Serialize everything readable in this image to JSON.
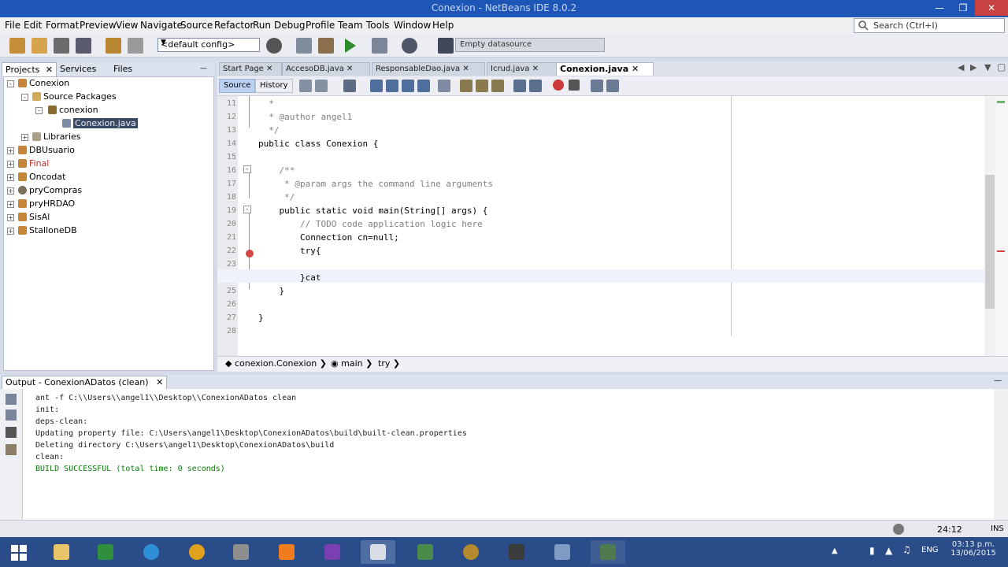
{
  "window": {
    "title": "Conexion - NetBeans IDE 8.0.2"
  },
  "menu": [
    "File",
    "Edit",
    "Format",
    "Preview",
    "View",
    "Navigate",
    "Source",
    "Refactor",
    "Run",
    "Debug",
    "Profile",
    "Team",
    "Tools",
    "Window",
    "Help"
  ],
  "search": {
    "placeholder": "Search (Ctrl+I)"
  },
  "toolbar": {
    "config": "<default config>",
    "datasource": "Empty datasource"
  },
  "left_panel": {
    "tabs": [
      "Projects",
      "Services",
      "Files"
    ],
    "tree": [
      {
        "label": "Conexion",
        "level": 0
      },
      {
        "label": "Source Packages",
        "level": 1
      },
      {
        "label": "conexion",
        "level": 2
      },
      {
        "label": "Conexion.java",
        "level": 3,
        "selected": true
      },
      {
        "label": "Libraries",
        "level": 1
      },
      {
        "label": "DBUsuario",
        "level": 0
      },
      {
        "label": "Final",
        "level": 0,
        "color": "#c62828"
      },
      {
        "label": "Oncodat",
        "level": 0
      },
      {
        "label": "pryCompras",
        "level": 0
      },
      {
        "label": "pryHRDAO",
        "level": 0
      },
      {
        "label": "SisAl",
        "level": 0
      },
      {
        "label": "StalloneDB",
        "level": 0
      }
    ]
  },
  "editor": {
    "tabs": [
      "Start Page",
      "AccesoDB.java",
      "ResponsableDao.java",
      "Icrud.java",
      "Conexion.java"
    ],
    "active_tab": "Conexion.java",
    "view_tabs": [
      "Source",
      "History"
    ],
    "lines": [
      {
        "n": "11",
        "text": "  *"
      },
      {
        "n": "12",
        "text": "  * @author angel1"
      },
      {
        "n": "13",
        "text": "  */"
      },
      {
        "n": "14",
        "text": "public class Conexion {"
      },
      {
        "n": "15",
        "text": ""
      },
      {
        "n": "16",
        "text": "    /**"
      },
      {
        "n": "17",
        "text": "     * @param args the command line arguments"
      },
      {
        "n": "18",
        "text": "     */"
      },
      {
        "n": "19",
        "text": "    public static void main(String[] args) {"
      },
      {
        "n": "20",
        "text": "        // TODO code application logic here"
      },
      {
        "n": "21",
        "text": "        Connection cn=null;"
      },
      {
        "n": "22",
        "text": "        try{"
      },
      {
        "n": "23",
        "text": ""
      },
      {
        "n": "24",
        "text": "        }cat"
      },
      {
        "n": "25",
        "text": "    }"
      },
      {
        "n": "26",
        "text": ""
      },
      {
        "n": "27",
        "text": "}"
      },
      {
        "n": "28",
        "text": ""
      }
    ],
    "breadcrumb": [
      "conexion.Conexion",
      "main",
      "try"
    ]
  },
  "output": {
    "title": "Output - ConexionADatos (clean)",
    "lines": [
      "ant -f C:\\\\Users\\\\angel1\\\\Desktop\\\\ConexionADatos clean",
      "init:",
      "deps-clean:",
      "Updating property file: C:\\Users\\angel1\\Desktop\\ConexionADatos\\build\\built-clean.properties",
      "Deleting directory C:\\Users\\angel1\\Desktop\\ConexionADatos\\build",
      "clean:",
      "BUILD SUCCESSFUL (total time: 0 seconds)"
    ]
  },
  "status": {
    "position": "24:12",
    "mode": "INS"
  },
  "taskbar": {
    "lang": "ENG",
    "time": "03:13 p.m.",
    "date": "13/06/2015"
  },
  "colors": {
    "accent": "#1e56b7",
    "taskbar": "#2a4c88",
    "success": "#0c7b0c"
  }
}
